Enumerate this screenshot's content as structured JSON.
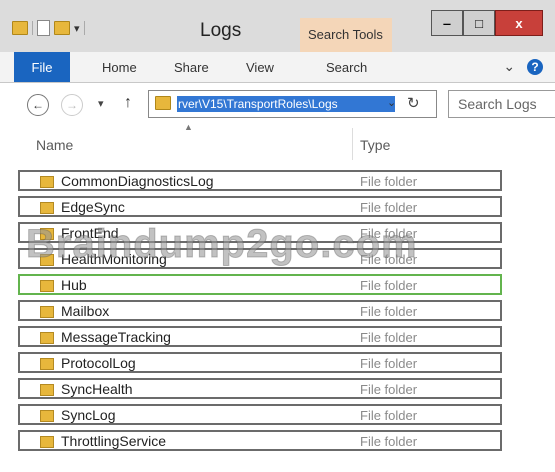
{
  "window": {
    "title": "Logs",
    "context_tab": "Search Tools",
    "controls": {
      "minimize": "‒",
      "maximize": "□",
      "close": "x"
    }
  },
  "ribbon": {
    "tabs": [
      "File",
      "Home",
      "Share",
      "View",
      "Search"
    ],
    "expand_glyph": "⌄",
    "help_glyph": "?",
    "file_tab_color": "#1a65c0"
  },
  "navigation": {
    "back": "←",
    "forward": "→",
    "recent": "▾",
    "up": "↑",
    "address_text": "rver\\V15\\TransportRoles\\Logs",
    "address_dropdown": "⌄",
    "refresh": "↻",
    "search_placeholder": "Search Logs"
  },
  "columns": {
    "name": "Name",
    "type": "Type",
    "sort_caret": "▲"
  },
  "rows": [
    {
      "name": "CommonDiagnosticsLog",
      "type": "File folder"
    },
    {
      "name": "EdgeSync",
      "type": "File folder"
    },
    {
      "name": "FrontEnd",
      "type": "File folder"
    },
    {
      "name": "HealthMonitoring",
      "type": "File folder"
    },
    {
      "name": "Hub",
      "type": "File folder"
    },
    {
      "name": "Mailbox",
      "type": "File folder"
    },
    {
      "name": "MessageTracking",
      "type": "File folder"
    },
    {
      "name": "ProtocolLog",
      "type": "File folder"
    },
    {
      "name": "SyncHealth",
      "type": "File folder"
    },
    {
      "name": "SyncLog",
      "type": "File folder"
    },
    {
      "name": "ThrottlingService",
      "type": "File folder"
    }
  ],
  "highlight_color": "#63b44e",
  "watermark": "Braindump2go.com"
}
